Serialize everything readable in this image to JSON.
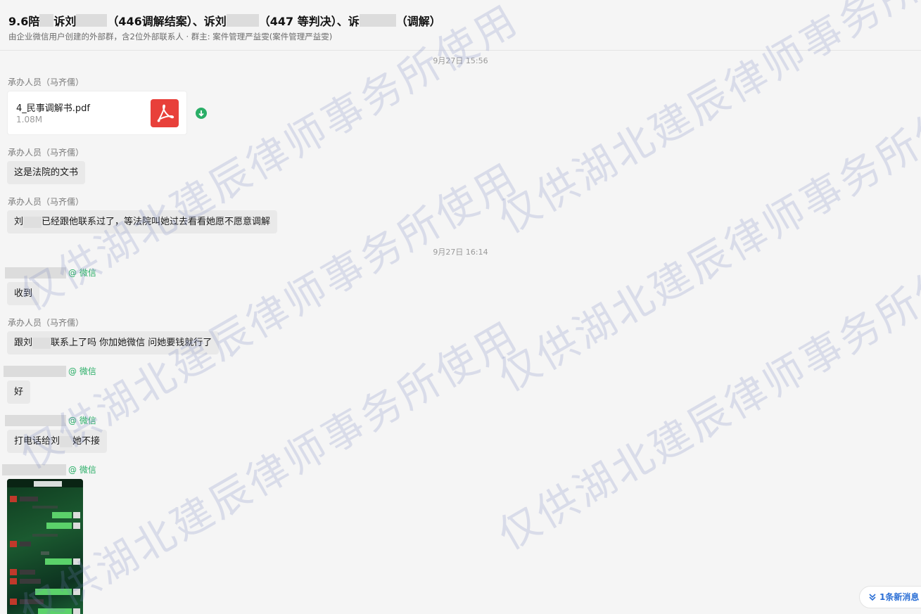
{
  "header": {
    "title_parts": [
      "9.6陪",
      "诉刘",
      "（446调解结案）、诉刘",
      "（447 等判决）、诉",
      "（调解）"
    ],
    "subtitle": "由企业微信用户创建的外部群，含2位外部联系人 · 群主: 案件管理严益雯(案件管理严益雯)"
  },
  "timestamps": [
    "9月27日 15:56",
    "9月27日 16:14"
  ],
  "wechat_suffix": "@ 微信",
  "messages": {
    "m1_sender": "承办人员（马齐儒）",
    "file_name": "4_民事调解书.pdf",
    "file_size": "1.08M",
    "m2_sender": "承办人员（马齐儒）",
    "m2_text": "这是法院的文书",
    "m3_sender": "承办人员（马齐儒）",
    "m3_text_a": "刘",
    "m3_text_b": "已经跟他联系过了，等法院叫她过去看看她愿不愿意调解",
    "m4_text": "收到",
    "m5_sender": "承办人员（马齐儒）",
    "m5_text_a": "跟刘",
    "m5_text_b": "联系上了吗 你加她微信 问她要钱就行了",
    "m6_text": "好",
    "m7_text_a": "打电话给刘",
    "m7_text_b": "她不接"
  },
  "new_message_button": "1条新消息",
  "watermark_text": "仅供湖北建辰律师事务所使用",
  "colors": {
    "accent_green": "#2aae67",
    "pdf_red": "#e8403a",
    "link_blue": "#2b6fd6"
  }
}
